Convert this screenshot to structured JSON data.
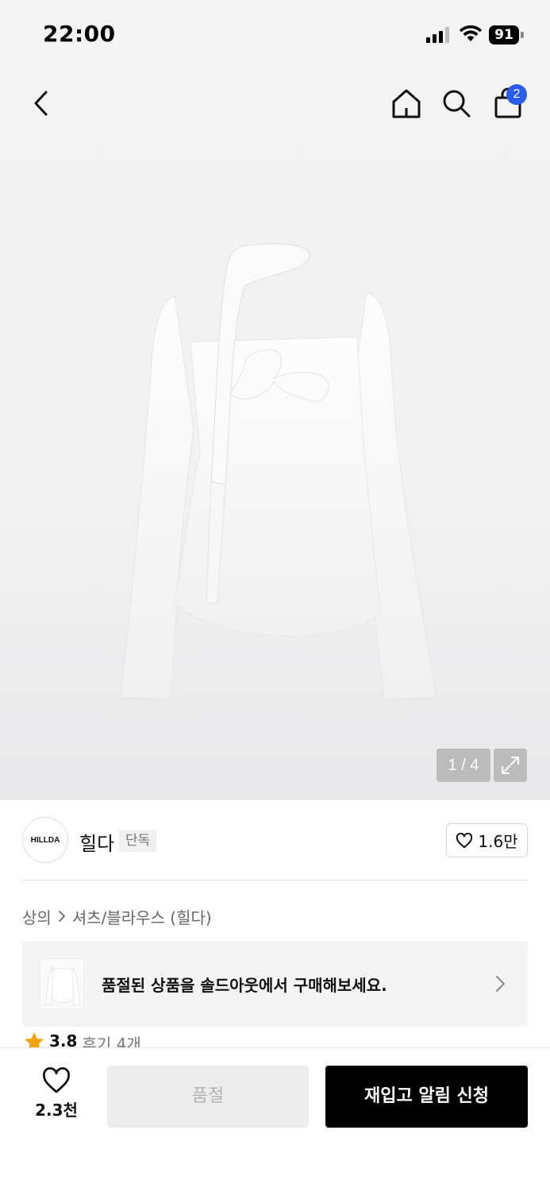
{
  "status_bar": {
    "time": "22:00",
    "battery": "91"
  },
  "nav": {
    "cart_badge": "2"
  },
  "gallery": {
    "counter": "1 / 4"
  },
  "brand": {
    "logo_text": "HILLDA",
    "name": "힐다",
    "badge": "단독",
    "likes": "1.6만"
  },
  "breadcrumb": {
    "category": "상의",
    "subcategory": "셔츠/블라우스 (힐다)"
  },
  "soldout_banner": {
    "text": "품절된 상품을 솔드아웃에서 구매해보세요."
  },
  "rating": {
    "value": "3.8",
    "reviews": "후기 4개"
  },
  "bottom_bar": {
    "wish_count": "2.3천",
    "soldout_label": "품절",
    "restock_label": "재입고 알림 신청"
  },
  "colors": {
    "accent_blue": "#2a5bf0",
    "star": "#f5a300",
    "cta": "#000000"
  }
}
